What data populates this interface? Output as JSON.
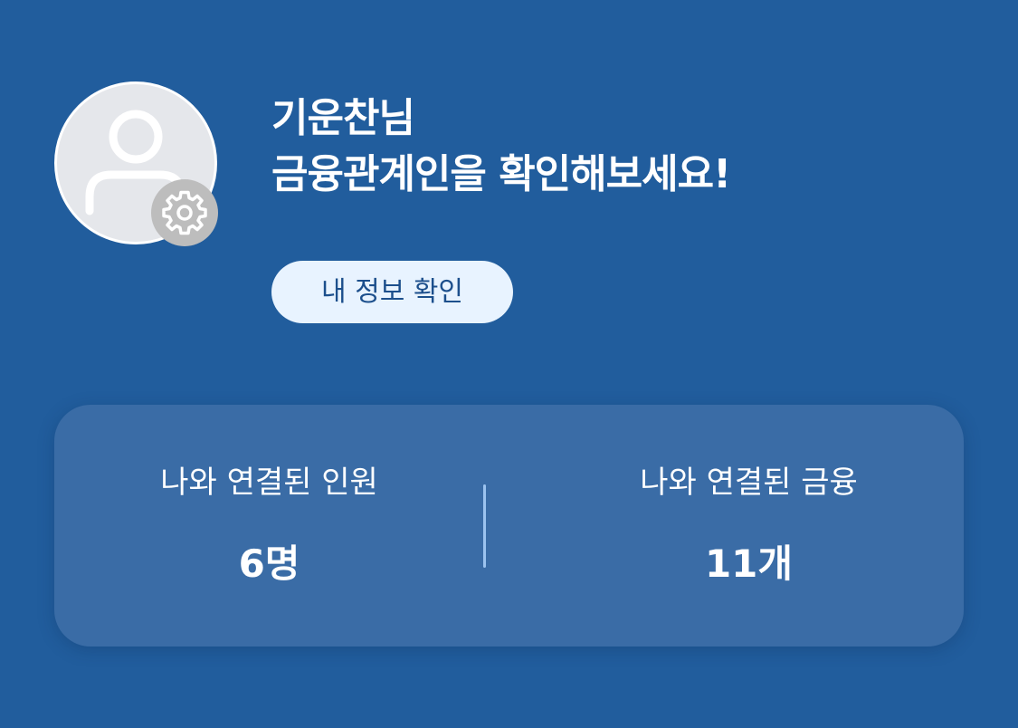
{
  "profile": {
    "greeting_line1": "기운찬님",
    "greeting_line2": "금융관계인을 확인해보세요!",
    "info_button_label": "내 정보 확인",
    "avatar_icon": "person-icon",
    "settings_icon": "gear-icon"
  },
  "stats": {
    "people": {
      "label": "나와 연결된 인원",
      "value": "6명"
    },
    "finance": {
      "label": "나와 연결된 금융",
      "value": "11개"
    }
  },
  "colors": {
    "background": "#215d9d",
    "card": "#3a6ca6",
    "button_bg": "#e8f3ff",
    "button_text": "#1c4f8c",
    "divider": "#9cc3ef",
    "avatar_bg": "#e5e7eb",
    "settings_badge": "#bdbdbd"
  }
}
